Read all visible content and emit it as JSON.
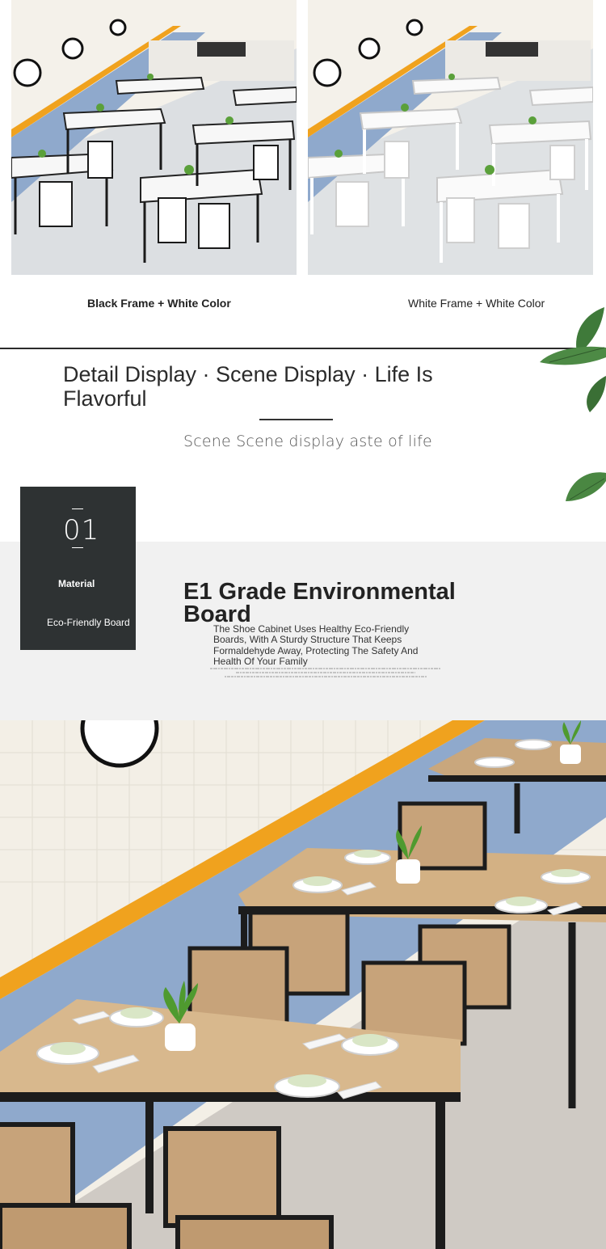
{
  "variants": [
    {
      "caption": "Black Frame + White Color"
    },
    {
      "caption": "White Frame + White Color"
    }
  ],
  "section": {
    "headline": "Detail Display · Scene Display · Life Is Flavorful",
    "subtitle": "Scene Scene display aste of life"
  },
  "material_card": {
    "number": "01",
    "label": "Material",
    "description": "Eco-Friendly Board"
  },
  "feature": {
    "title": "E1 Grade Environmental Board",
    "body": "The Shoe Cabinet Uses Healthy Eco-Friendly Boards, With A Sturdy Structure That Keeps Formaldehyde Away, Protecting The Safety And Health Of Your Family"
  },
  "colors": {
    "dark_card": "#2e3233",
    "band": "#f1f1f1",
    "tile_blue": "#8fa9cc",
    "tile_orange": "#f0a21e",
    "wood": "#c9a77d"
  },
  "icons": [
    "plant-leaf-icon"
  ]
}
